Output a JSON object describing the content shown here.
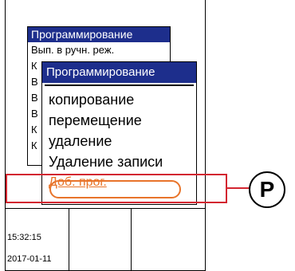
{
  "status": {
    "time": "15:32:15",
    "date": "2017-01-11"
  },
  "menu_back": {
    "title": "Программирование",
    "items": [
      "Вып. в ручн. реж.",
      "К",
      "В",
      "В",
      "В",
      "К",
      "К"
    ]
  },
  "menu_front": {
    "title": "Программирование",
    "items": [
      "копирование",
      "перемещение",
      "удаление",
      "Удаление записи"
    ],
    "selected": "Доб. прог."
  },
  "callout": {
    "label": "P"
  },
  "colors": {
    "title_bg": "#1d2e8c",
    "highlight": "#d32630",
    "selection": "#e8742a"
  }
}
